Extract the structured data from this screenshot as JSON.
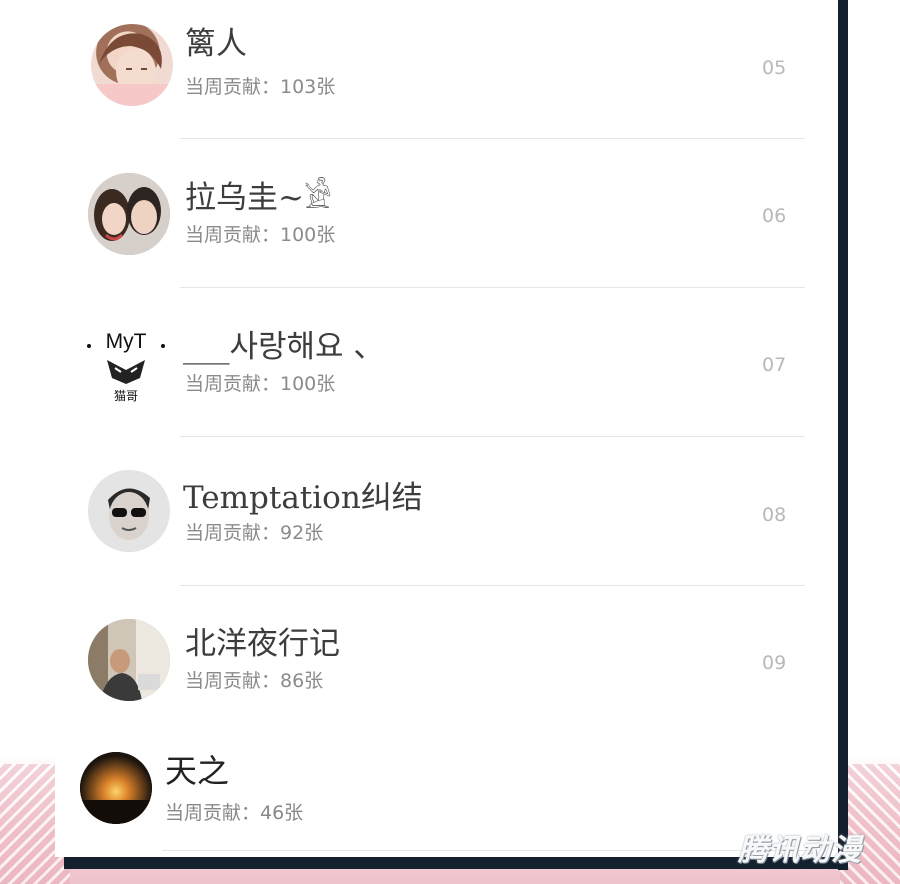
{
  "entries": [
    {
      "name": "篱人",
      "contribution": "当周贡献：103张",
      "rank": "05"
    },
    {
      "name": "拉乌圭~𓀀",
      "contribution": "当周贡献：100张",
      "rank": "06"
    },
    {
      "name": "___사랑해요 、",
      "contribution": "当周贡献：100张",
      "rank": "07",
      "avatar_text": "MyT",
      "avatar_sub": "猫哥"
    },
    {
      "name": "Temptation纠结",
      "contribution": "当周贡献：92张",
      "rank": "08"
    },
    {
      "name": "北洋夜行记",
      "contribution": "当周贡献：86张",
      "rank": "09"
    },
    {
      "name": "天之",
      "contribution": "当周贡献：46张"
    }
  ],
  "watermark": "腾讯动漫"
}
